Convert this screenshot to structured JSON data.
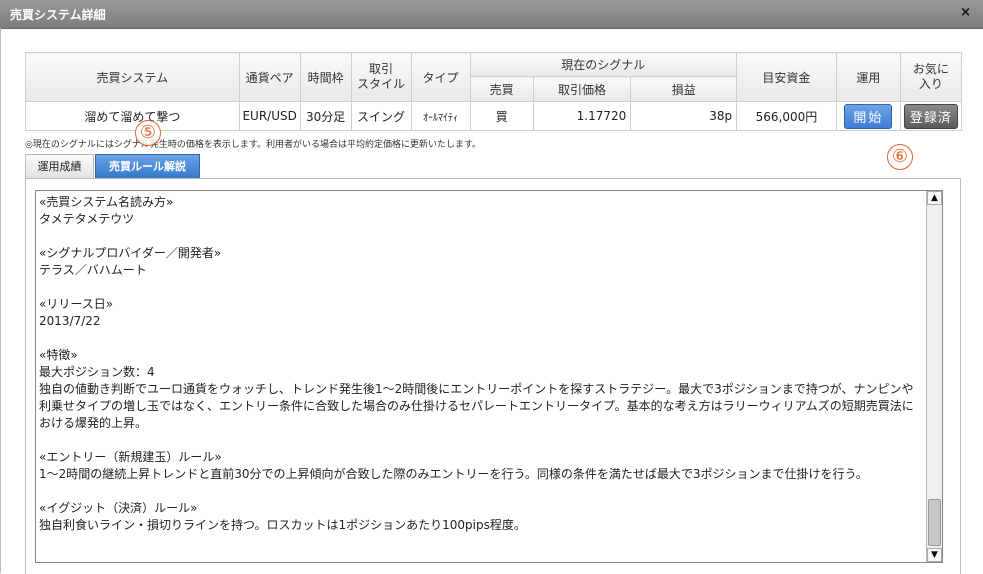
{
  "window": {
    "title": "売買システム詳細",
    "close": "×"
  },
  "table": {
    "headers": {
      "system": "売買システム",
      "pair": "通貨ペア",
      "timeframe": "時間枠",
      "style": "取引\nスタイル",
      "type": "タイプ",
      "signal": "現在のシグナル",
      "side": "売買",
      "price": "取引価格",
      "pl": "損益",
      "capital": "目安資金",
      "operate": "運用",
      "favorite": "お気に\n入り"
    },
    "row": {
      "system": "溜めて溜めて撃つ",
      "pair": "EUR/USD",
      "timeframe": "30分足",
      "style": "スイング",
      "type": "ｵｰﾙﾏｲﾃｨ",
      "side": "買",
      "price": "1.17720",
      "pl": "38p",
      "capital": "566,000円",
      "start_button": "開始",
      "registered_button": "登録済"
    }
  },
  "note": "◎現在のシグナルにはシグナル発生時の価格を表示します。利用者がいる場合は平均約定価格に更新いたします。",
  "markers": {
    "five": "⑤",
    "six": "⑥"
  },
  "tabs": {
    "performance": "運用成績",
    "rules": "売買ルール解説"
  },
  "rules_text": "«売買システム名読み方»\nタメテタメテウツ\n\n«シグナルプロバイダー／開発者»\nテラス／バハムート\n\n«リリース日»\n2013/7/22\n\n«特徴»\n最大ポジション数：4\n独自の値動き判断でユーロ通貨をウォッチし、トレンド発生後1〜2時間後にエントリーポイントを探すストラテジー。最大で3ポジションまで持つが、ナンピンや利乗せタイプの増し玉ではなく、エントリー条件に合致した場合のみ仕掛けるセパレートエントリータイプ。基本的な考え方はラリーウィリアムズの短期売買法における爆発的上昇。\n\n«エントリー（新規建玉）ルール»\n1〜2時間の継続上昇トレンドと直前30分での上昇傾向が合致した際のみエントリーを行う。同様の条件を満たせば最大で3ポジションまで仕掛けを行う。\n\n«イグジット（決済）ルール»\n独自利食いライン・損切りラインを持つ。ロスカットは1ポジションあたり100pips程度。",
  "scroll": {
    "up": "▲",
    "down": "▼"
  }
}
